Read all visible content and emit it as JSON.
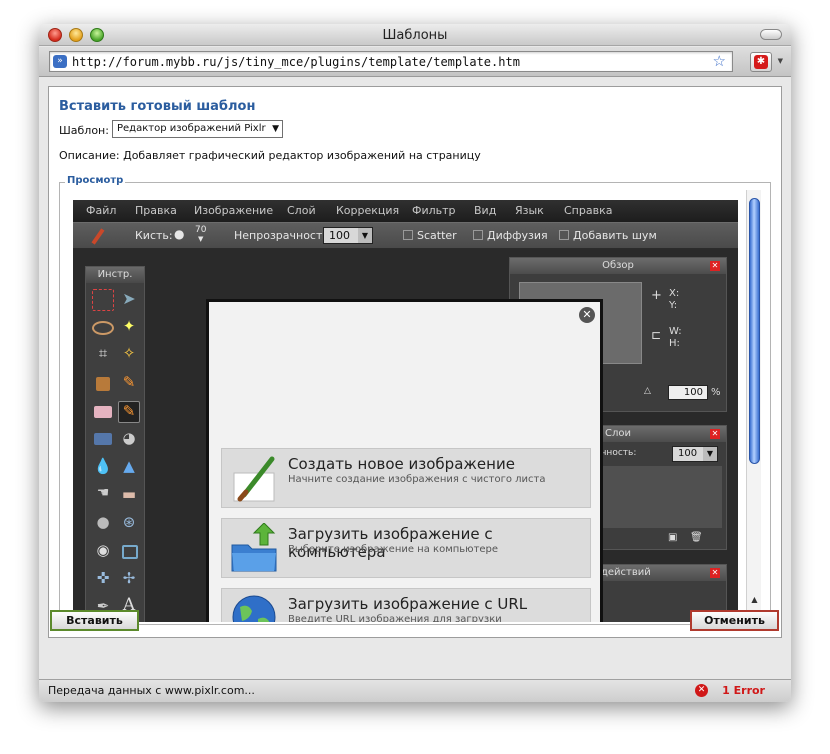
{
  "window": {
    "title": "Шаблоны"
  },
  "address": {
    "url": "http://forum.mybb.ru/js/tiny_mce/plugins/template/template.htm"
  },
  "dialog": {
    "heading": "Вставить готовый шаблон",
    "template_label": "Шаблон:",
    "template_value": "Редактор изображений Pixlr",
    "description": "Описание: Добавляет графический редактор изображений на страницу",
    "preview_legend": "Просмотр"
  },
  "pixlr": {
    "menu": [
      "Файл",
      "Правка",
      "Изображение",
      "Слой",
      "Коррекция",
      "Фильтр",
      "Вид",
      "Язык",
      "Справка"
    ],
    "brush_label": "Кисть:",
    "brush_size": "70",
    "opacity_label": "Непрозрачность:",
    "opacity_value": "100",
    "scatter": "Scatter",
    "diffusion": "Диффузия",
    "noise": "Добавить шум",
    "tools_title": "Инстр.",
    "nav_title": "Обзор",
    "nav_x": "X:",
    "nav_y": "Y:",
    "nav_w": "W:",
    "nav_h": "H:",
    "zoom_value": "100",
    "zoom_unit": "%",
    "layers_title": "Слои",
    "layers_opacity": "прозрачность:",
    "layers_opacity_value": "100",
    "history_title": "ия действий",
    "options": [
      {
        "title": "Создать новое изображение",
        "subtitle": "Начните создание изображения с чистого листа"
      },
      {
        "title": "Загрузить изображение с компьютера",
        "subtitle": "Выберите изображение на компьютере"
      },
      {
        "title": "Загрузить изображение с URL",
        "subtitle": "Введите URL изображения для загрузки"
      }
    ]
  },
  "buttons": {
    "insert": "Вставить",
    "cancel": "Отменить"
  },
  "status": {
    "text": "Передача данных с www.pixlr.com...",
    "error": "1 Error"
  },
  "colors": {
    "accent": "#2b5d9f",
    "insert_border": "#5c8a2c",
    "cancel_border": "#b03a2e",
    "error": "#d01818"
  }
}
